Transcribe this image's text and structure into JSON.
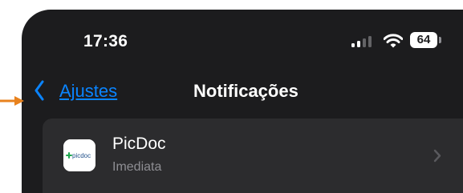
{
  "status_bar": {
    "time": "17:36",
    "battery": "64",
    "icons": [
      "cellular-signal-icon",
      "wifi-icon",
      "battery-icon"
    ]
  },
  "nav": {
    "back_label": "Ajustes",
    "title": "Notificações"
  },
  "list": {
    "items": [
      {
        "name": "PicDoc",
        "subtitle": "Imediata",
        "icon": "picdoc",
        "icon_text": "picdoc"
      }
    ]
  },
  "colors": {
    "background": "#1c1c1e",
    "row": "#2c2c2e",
    "accent": "#0a84ff",
    "annotation_arrow": "#e8821e"
  }
}
